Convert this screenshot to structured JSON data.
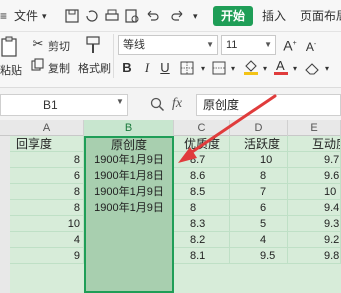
{
  "menubar": {
    "file_label": "文件",
    "start_label": "开始",
    "insert_label": "插入",
    "page_layout_label": "页面布局"
  },
  "ribbon": {
    "paste_label": "粘贴",
    "cut_label": "剪切",
    "copy_label": "复制",
    "format_painter_label": "格式刷",
    "font_name": "等线",
    "font_size": "11"
  },
  "formula_bar": {
    "cell_ref": "B1",
    "fx_label": "fx",
    "formula_value": "原创度"
  },
  "sheet": {
    "columns": [
      "A",
      "B",
      "C",
      "D",
      "E"
    ],
    "headers": [
      "回享度",
      "原创度",
      "优质度",
      "活跃度",
      "互动度"
    ],
    "col_a": [
      "8",
      "6",
      "8",
      "8",
      "10",
      "4",
      "9"
    ],
    "col_b": [
      "1900年1月9日",
      "1900年1月8日",
      "1900年1月9日",
      "1900年1月9日",
      "",
      "",
      ""
    ],
    "col_c": [
      "8.7",
      "8.6",
      "8.5",
      "8",
      "8.3",
      "8.2",
      "8.1"
    ],
    "col_d": [
      "10",
      "8",
      "7",
      "6",
      "5",
      "4",
      "9.5"
    ],
    "col_e": [
      "9.7",
      "9.6",
      "10",
      "9.4",
      "9.3",
      "9.2",
      "9.8"
    ]
  },
  "colors": {
    "accent": "#1f9e57",
    "arrow": "#e03c3c",
    "selection_fill": "#a8cfaf",
    "grid_fill": "#d7ecd9"
  }
}
